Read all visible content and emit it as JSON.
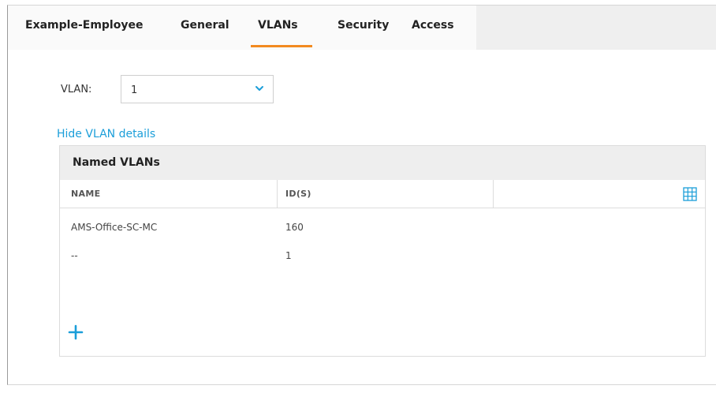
{
  "tabs": [
    {
      "label": "Example-Employee"
    },
    {
      "label": "General"
    },
    {
      "label": "VLANs"
    },
    {
      "label": "Security"
    },
    {
      "label": "Access"
    }
  ],
  "active_tab": "VLANs",
  "vlan": {
    "label": "VLAN:",
    "selected": "1"
  },
  "hide_details_link": "Hide VLAN details",
  "panel": {
    "title": "Named VLANs",
    "columns": [
      "NAME",
      "ID(S)"
    ],
    "rows": [
      {
        "name": "AMS-Office-SC-MC",
        "ids": "160"
      },
      {
        "name": "--",
        "ids": "1"
      }
    ]
  },
  "colors": {
    "accent": "#f28a1f",
    "link": "#1b9ed9"
  },
  "icons": {
    "dropdown": "chevron-down-icon",
    "columns": "grid-icon",
    "add": "plus-icon"
  }
}
